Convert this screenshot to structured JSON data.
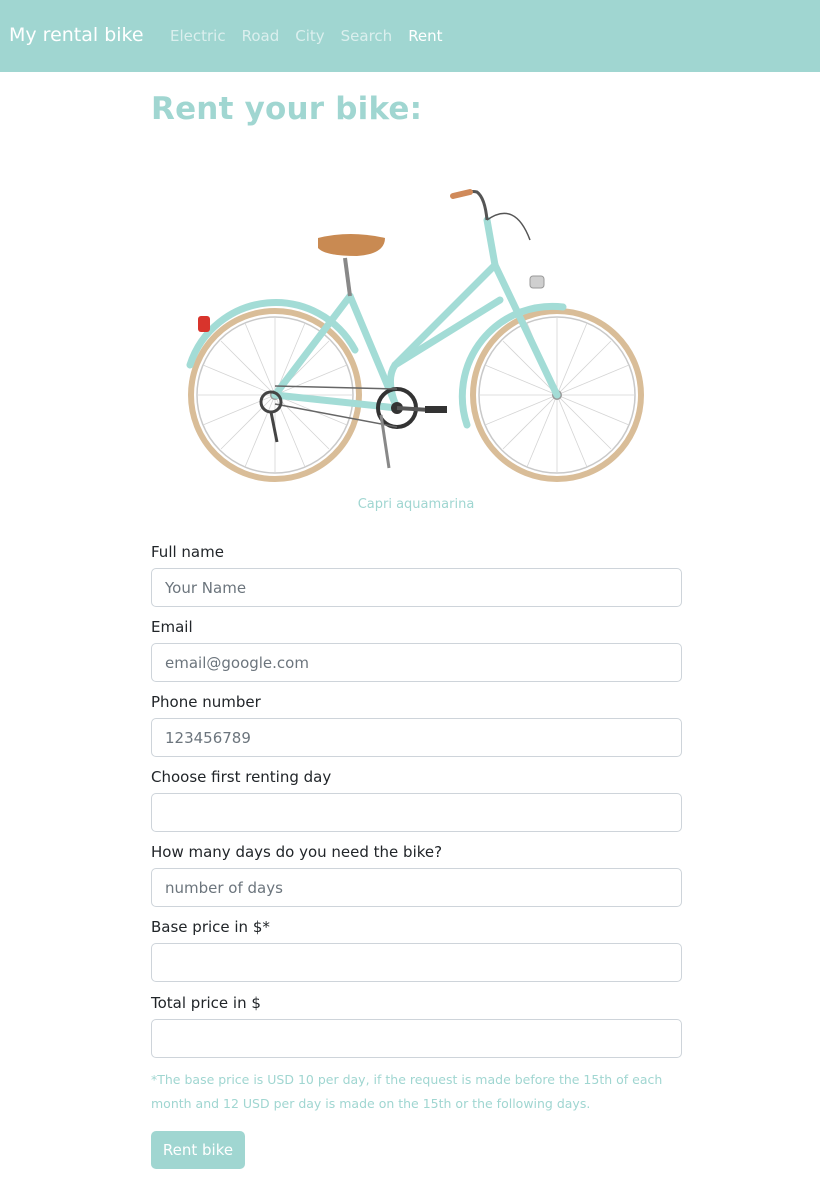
{
  "navbar": {
    "brand": "My rental bike",
    "links": [
      {
        "label": "Electric",
        "active": false
      },
      {
        "label": "Road",
        "active": false
      },
      {
        "label": "City",
        "active": false
      },
      {
        "label": "Search",
        "active": false
      },
      {
        "label": "Rent",
        "active": true
      }
    ]
  },
  "page": {
    "title": "Rent your bike:",
    "bike_caption": "Capri aquamarina"
  },
  "form": {
    "fields": [
      {
        "label": "Full name",
        "placeholder": "Your Name",
        "value": ""
      },
      {
        "label": "Email",
        "placeholder": "email@google.com",
        "value": ""
      },
      {
        "label": "Phone number",
        "placeholder": "123456789",
        "value": ""
      },
      {
        "label": "Choose first renting day",
        "placeholder": "",
        "value": ""
      },
      {
        "label": "How many days do you need the bike?",
        "placeholder": "number of days",
        "value": ""
      },
      {
        "label": "Base price in $*",
        "placeholder": "",
        "value": ""
      },
      {
        "label": "Total price in $",
        "placeholder": "",
        "value": ""
      }
    ],
    "note": "*The base price is USD 10 per day, if the request is made before the 15th of each month and 12 USD per day is made on the 15th or the following days.",
    "submit_label": "Rent bike"
  },
  "colors": {
    "accent": "#a0d6d1",
    "bike_frame": "#a3dcd6",
    "tire": "#d9bd98",
    "saddle": "#c98a52"
  },
  "icons": {
    "bike_image": "bicycle-photo"
  }
}
